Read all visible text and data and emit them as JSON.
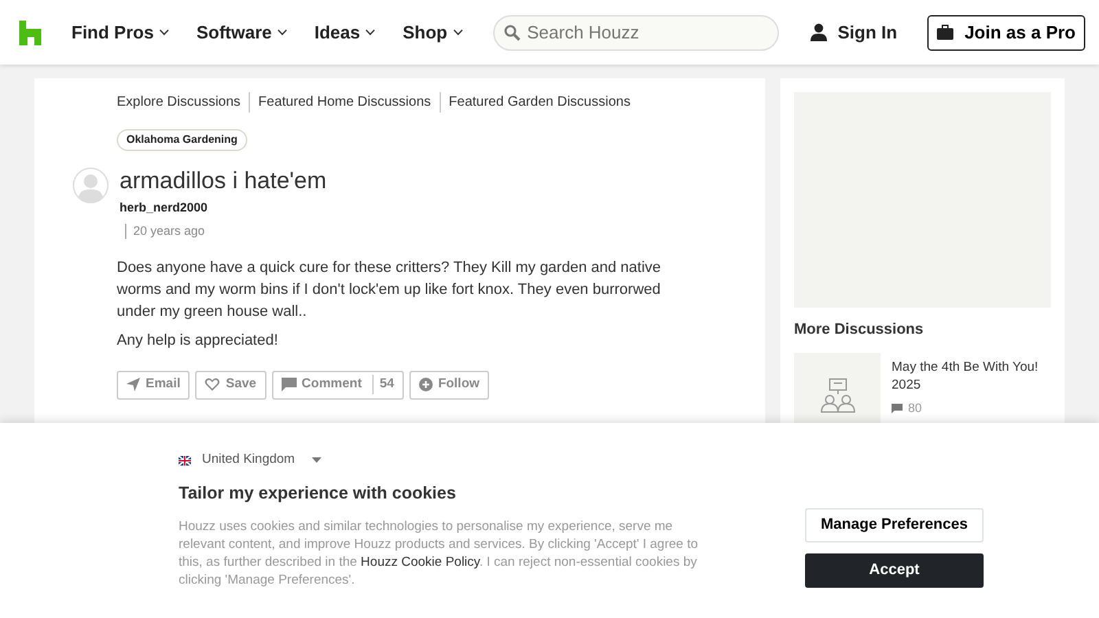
{
  "header": {
    "nav": [
      {
        "label": "Find Pros"
      },
      {
        "label": "Software"
      },
      {
        "label": "Ideas"
      },
      {
        "label": "Shop"
      }
    ],
    "search": {
      "placeholder": "Search Houzz"
    },
    "sign_in": "Sign In",
    "join": "Join as a Pro"
  },
  "breadcrumbs": [
    "Explore Discussions",
    "Featured Home Discussions",
    "Featured Garden Discussions"
  ],
  "tag": "Oklahoma Gardening",
  "post": {
    "title": "armadillos i hate'em",
    "author": "herb_nerd2000",
    "time": "20 years ago",
    "paragraphs": [
      "Does anyone have a quick cure for these critters? They Kill my garden and native worms and my worm bins if I don't lock'em up like fort knox. They even burrorwed under my green house wall..",
      "Any help is appreciated!"
    ]
  },
  "actions": [
    {
      "kind": "email",
      "label": "Email"
    },
    {
      "kind": "save",
      "label": "Save"
    },
    {
      "kind": "comment",
      "label": "Comment",
      "count": "54"
    },
    {
      "kind": "follow",
      "label": "Follow"
    }
  ],
  "sidebar": {
    "heading": "More Discussions",
    "items": [
      {
        "title": "May the 4th Be With You! 2025",
        "count": "80"
      }
    ]
  },
  "cookie_banner": {
    "region": "United Kingdom",
    "title": "Tailor my experience with cookies",
    "text_before": "Houzz uses cookies and similar technologies to personalise my experience, serve me relevant content, and improve Houzz products and services. By clicking 'Accept' I agree to this, as further described in the ",
    "link": "Houzz Cookie Policy",
    "text_after": ". I can reject non-essential cookies by clicking 'Manage Preferences'.",
    "buttons": [
      {
        "kind": "secondary",
        "label": "Manage Preferences"
      },
      {
        "kind": "primary",
        "label": "Accept"
      }
    ]
  }
}
